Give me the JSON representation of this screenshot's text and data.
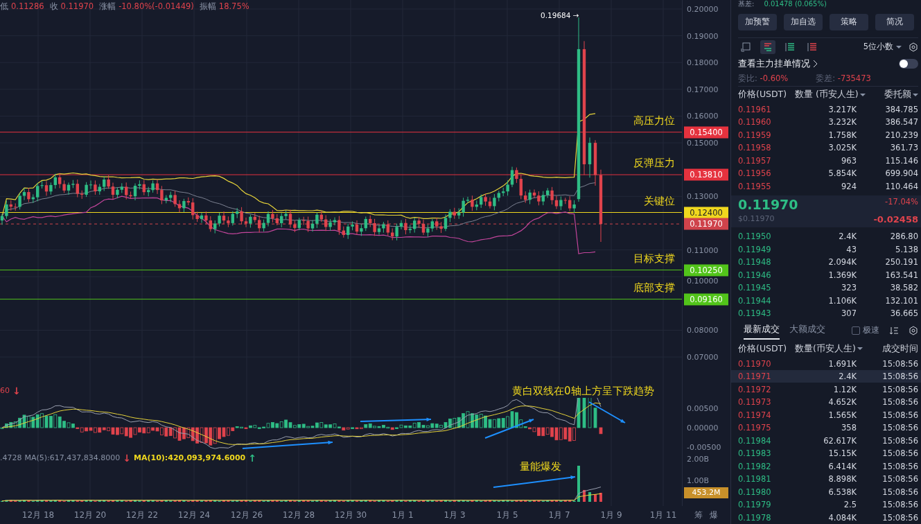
{
  "chart": {
    "header_stats": [
      {
        "label": "低",
        "value": "0.11286"
      },
      {
        "label": "收",
        "value": "0.11970"
      },
      {
        "label": "涨幅",
        "value": "-10.80%(-0.01449)"
      },
      {
        "label": "振幅",
        "value": "18.75%"
      }
    ],
    "peak_label": "0.19684 →",
    "price_axis": [
      "0.20000",
      "0.19000",
      "0.18000",
      "0.17000",
      "0.16000",
      "0.15000",
      "0.13000",
      "0.11000",
      "0.10000",
      "0.08000",
      "0.07000"
    ],
    "levels": [
      {
        "note": "高压力位",
        "price": "0.15400",
        "kind": "resistance",
        "color": "#e5323e"
      },
      {
        "note": "反弹压力",
        "price": "0.13810",
        "kind": "resistance",
        "color": "#e5323e"
      },
      {
        "note": "关键位",
        "price": "0.12400",
        "kind": "key",
        "color": "#f0d81e"
      },
      {
        "price": "0.11970",
        "kind": "current",
        "color": "#cf434b"
      },
      {
        "note": "目标支撑",
        "price": "0.10250",
        "kind": "support",
        "color": "#52c41a"
      },
      {
        "note": "底部支撑",
        "price": "0.09160",
        "kind": "support",
        "color": "#52c41a"
      }
    ],
    "macd": {
      "legend": {
        "text": "60",
        "arrow": {
          "text": "↓",
          "color": "#e0434c"
        }
      },
      "axis": [
        "0.00500",
        "0.00000",
        "-0.00500"
      ],
      "note": "黄白双线在0轴上方呈下跌趋势"
    },
    "volume": {
      "legend": [
        {
          "text": ".4728",
          "color": "#8a93a6"
        },
        {
          "text": "MA(5):617,437,834.8000",
          "arrow": {
            "text": "↓",
            "color": "#e0434c"
          },
          "color": "#8a93a6"
        },
        {
          "text": "MA(10):420,093,974.6000",
          "arrow": {
            "text": "↑",
            "color": "#2ebd85"
          },
          "color": "#f0d81e"
        }
      ],
      "axis": [
        "2.00B",
        "1.00B"
      ],
      "badge": "453.2M",
      "note": "量能爆发"
    },
    "x_axis": [
      "12月 18",
      "12月 20",
      "12月 22",
      "12月 24",
      "12月 26",
      "12月 28",
      "12月 30",
      "1月 1",
      "1月 3",
      "1月 5",
      "1月 7",
      "1月 9",
      "1月 11"
    ],
    "corner_tabs": [
      "筹",
      "爆"
    ]
  },
  "side_panel": {
    "basis": {
      "label": "基差:",
      "value": "0.01478 (0.065%)"
    },
    "buttons": [
      "加预警",
      "加自选",
      "策略",
      "简况"
    ],
    "view_modes": [
      {
        "kind": "plain",
        "selected": false
      },
      {
        "kind": "both",
        "selected": true
      },
      {
        "kind": "bids",
        "selected": false
      },
      {
        "kind": "asks",
        "selected": false
      }
    ],
    "precision": "5位小数",
    "depth_link": "查看主力挂单情况",
    "depth_toggle": {
      "on": false
    },
    "ratios": [
      {
        "label": "委比:",
        "value": "-0.60%"
      },
      {
        "label": "委差:",
        "value": "-735473"
      }
    ],
    "book_columns": [
      "价格(USDT)",
      "数量 (币安人生)",
      "委托额"
    ],
    "asks": [
      {
        "price": "0.11961",
        "qty": "3.217K",
        "total": "384.785"
      },
      {
        "price": "0.11960",
        "qty": "3.232K",
        "total": "386.547"
      },
      {
        "price": "0.11959",
        "qty": "1.758K",
        "total": "210.239"
      },
      {
        "price": "0.11958",
        "qty": "3.025K",
        "total": "361.73"
      },
      {
        "price": "0.11957",
        "qty": "963",
        "total": "115.146"
      },
      {
        "price": "0.11956",
        "qty": "5.854K",
        "total": "699.904"
      },
      {
        "price": "0.11955",
        "qty": "924",
        "total": "110.464"
      }
    ],
    "mid": {
      "price": "0.11970",
      "usd": "$0.11970",
      "change_pct": "-17.04%",
      "change": "-0.02458"
    },
    "bids": [
      {
        "price": "0.11950",
        "qty": "2.4K",
        "total": "286.80"
      },
      {
        "price": "0.11949",
        "qty": "43",
        "total": "5.138"
      },
      {
        "price": "0.11948",
        "qty": "2.094K",
        "total": "250.191"
      },
      {
        "price": "0.11946",
        "qty": "1.369K",
        "total": "163.541"
      },
      {
        "price": "0.11945",
        "qty": "323",
        "total": "38.582"
      },
      {
        "price": "0.11944",
        "qty": "1.106K",
        "total": "132.101"
      },
      {
        "price": "0.11943",
        "qty": "307",
        "total": "36.665"
      }
    ],
    "trade_tabs": [
      {
        "label": "最新成交",
        "selected": true
      },
      {
        "label": "大额成交",
        "selected": false
      }
    ],
    "fast_mode": {
      "label": "极速",
      "checked": false
    },
    "trade_columns": [
      "价格(USDT)",
      "数量(币安人生)",
      "成交时间"
    ],
    "trades": [
      {
        "price": "0.11970",
        "qty": "1.691K",
        "time": "15:08:56",
        "buy": false,
        "selected": false
      },
      {
        "price": "0.11971",
        "qty": "2.4K",
        "time": "15:08:56",
        "buy": false,
        "selected": true
      },
      {
        "price": "0.11972",
        "qty": "1.12K",
        "time": "15:08:56",
        "buy": false,
        "selected": false
      },
      {
        "price": "0.11973",
        "qty": "4.652K",
        "time": "15:08:56",
        "buy": false,
        "selected": false
      },
      {
        "price": "0.11974",
        "qty": "1.565K",
        "time": "15:08:56",
        "buy": false,
        "selected": false
      },
      {
        "price": "0.11975",
        "qty": "358",
        "time": "15:08:56",
        "buy": false,
        "selected": false
      },
      {
        "price": "0.11984",
        "qty": "62.617K",
        "time": "15:08:56",
        "buy": true,
        "selected": false
      },
      {
        "price": "0.11983",
        "qty": "15.15K",
        "time": "15:08:56",
        "buy": true,
        "selected": false
      },
      {
        "price": "0.11982",
        "qty": "6.414K",
        "time": "15:08:56",
        "buy": true,
        "selected": false
      },
      {
        "price": "0.11981",
        "qty": "8.898K",
        "time": "15:08:56",
        "buy": true,
        "selected": false
      },
      {
        "price": "0.11980",
        "qty": "6.538K",
        "time": "15:08:56",
        "buy": true,
        "selected": false
      },
      {
        "price": "0.11979",
        "qty": "2.5",
        "time": "15:08:56",
        "buy": true,
        "selected": false
      },
      {
        "price": "0.11978",
        "qty": "4.084K",
        "time": "15:08:56",
        "buy": true,
        "selected": false
      }
    ]
  }
}
